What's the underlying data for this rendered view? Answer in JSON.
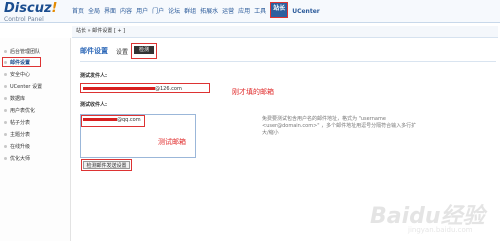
{
  "logo": {
    "brand": "Discuz",
    "bang": "!",
    "subtitle": "Control Panel"
  },
  "nav": {
    "items": [
      "首页",
      "全局",
      "界面",
      "内容",
      "用户",
      "门户",
      "论坛",
      "群组",
      "拓展水",
      "运营",
      "应用",
      "工具"
    ],
    "active": "站长",
    "ucenter": "UCenter"
  },
  "breadcrumb": {
    "text": "站长 » 邮件设置 [ + ]"
  },
  "sidebar": {
    "items": [
      "后台管理团队",
      "邮件设置",
      "安全中心",
      "UCenter 设置",
      "数据库",
      "用户表优化",
      "帖子分表",
      "主题分表",
      "在线升级",
      "优化大师"
    ],
    "active_index": 1
  },
  "section": {
    "title": "邮件设置",
    "tab_settings": "设置",
    "tab_check": "检测"
  },
  "sender": {
    "label": "测试发件人:",
    "value_suffix": "@126.com",
    "note": "刚才填的邮箱"
  },
  "recipient": {
    "label": "测试收件人:",
    "value_suffix": "@qq.com",
    "note": "测试邮箱"
  },
  "help_text": "免费要测试包含用户名的邮件地址，格式为 \"username <user@domain.com>\" ，多个邮件地址用逗号分隔符合输入多行扩大/缩小",
  "button": {
    "label": "检测邮件发送设置"
  },
  "watermark": {
    "text": "Baidu经验",
    "sub": "jingyan.baidu.com"
  },
  "colors": {
    "accent": "#2d5f9e",
    "highlight": "#dd3333",
    "note": "#e02a2a"
  }
}
